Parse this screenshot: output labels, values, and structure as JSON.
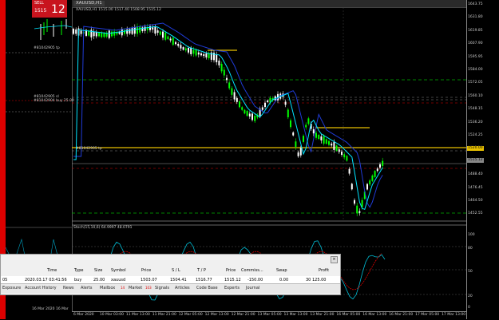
{
  "left_panel": {
    "sell_label": "SELL",
    "sell_price": "1515",
    "sell_big": "12",
    "labels": [
      "#81042905 tp",
      "#81042905 sl",
      "#81042904 buy 25.00"
    ],
    "footer_dates": [
      "16 Mar 2020",
      "16 Mar"
    ]
  },
  "chart": {
    "tab_title": "XAUUSD,H1",
    "ohlc_readout": "XAUUSD,H1  1515.00 1517.40 1508.95 1515.12",
    "symbol_label_mid": "#81042905 tp",
    "stoch_label": "Stoch(15,10,6) 64.9997 48.0791",
    "scale_labels": [
      "1643.75",
      "1631.80",
      "1619.85",
      "1607.90",
      "1595.95",
      "1584.00",
      "1572.05",
      "1560.10",
      "1548.15",
      "1536.20",
      "1524.25",
      "1512.30",
      "1500.35",
      "1488.40",
      "1476.45",
      "1464.50",
      "1452.55"
    ],
    "price_tags": [
      {
        "text": "1520.00",
        "color": "#e8c000"
      },
      {
        "text": "1515.12",
        "color": "#888888"
      }
    ],
    "stoch_scale": [
      "100",
      "80",
      "50",
      "20",
      "0"
    ],
    "time_labels": [
      "6 Mar 2020",
      "10 Mar 03:00",
      "11 Mar 13:00",
      "11 Mar 21:00",
      "12 Mar 05:00",
      "12 Mar 13:00",
      "12 Mar 21:00",
      "13 Mar 05:00",
      "13 Mar 13:00",
      "13 Mar 21:00",
      "16 Mar 05:00",
      "16 Mar 13:00",
      "16 Mar 21:00",
      "17 Mar 05:00",
      "17 Mar 13:00"
    ]
  },
  "terminal": {
    "headers": {
      "time": "Time",
      "type": "Type",
      "size": "Size",
      "symbol": "Symbol",
      "price": "Price",
      "sl": "S / L",
      "tp": "T / P",
      "price2": "Price",
      "commission": "Commiss...",
      "swap": "Swap",
      "profit": "Profit"
    },
    "row": {
      "ticket": "05",
      "time": "2020.03.17 03:41:56",
      "type": "buy",
      "size": "25.00",
      "symbol": "xauusd",
      "price": "1503.07",
      "sl": "1504.41",
      "tp": "1516.77",
      "price2": "1515.12",
      "commission": "-150.00",
      "swap": "0.00",
      "profit": "30 125.00"
    },
    "tabs": [
      "Exposure",
      "Account History",
      "News",
      "Alerts",
      "Mailbox",
      "Market",
      "Signals",
      "Articles",
      "Code Base",
      "Experts",
      "Journal"
    ],
    "badges": {
      "mailbox": "14",
      "market": "103"
    }
  },
  "colors": {
    "accent_yellow": "#e8c000",
    "up_candle": "#00ff00",
    "down_candle": "#ffffff",
    "ma_cyan": "#00e5ff",
    "ma_blue": "#1f3bd6"
  }
}
